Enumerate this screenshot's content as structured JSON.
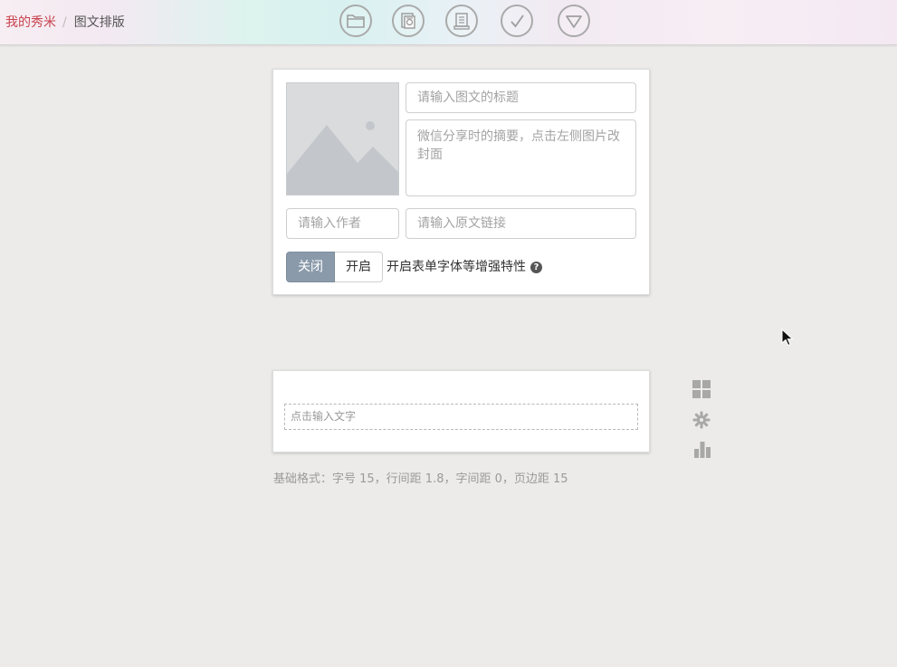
{
  "breadcrumb": {
    "home": "我的秀米",
    "separator": "/",
    "current": "图文排版"
  },
  "toolbar": {
    "buttons": [
      "folder-icon",
      "save-copy-icon",
      "preview-icon",
      "check-icon",
      "more-icon"
    ]
  },
  "article": {
    "title_placeholder": "请输入图文的标题",
    "summary_placeholder": "微信分享时的摘要，点击左侧图片改封面",
    "author_placeholder": "请输入作者",
    "source_link_placeholder": "请输入原文链接",
    "toggle_off_label": "关闭",
    "toggle_on_label": "开启",
    "enhance_label": "开启表单字体等增强特性",
    "help_glyph": "?"
  },
  "editor": {
    "placeholder": "点击输入文字"
  },
  "side_tools": [
    "grid-icon",
    "gear-icon",
    "bar-chart-icon"
  ],
  "format_info": "基础格式：字号 15，行间距 1.8，字间距 0，页边距 15",
  "colors": {
    "brand_red": "#c8424c",
    "toggle_active": "#8a9aaa",
    "background": "#ecebe9"
  }
}
